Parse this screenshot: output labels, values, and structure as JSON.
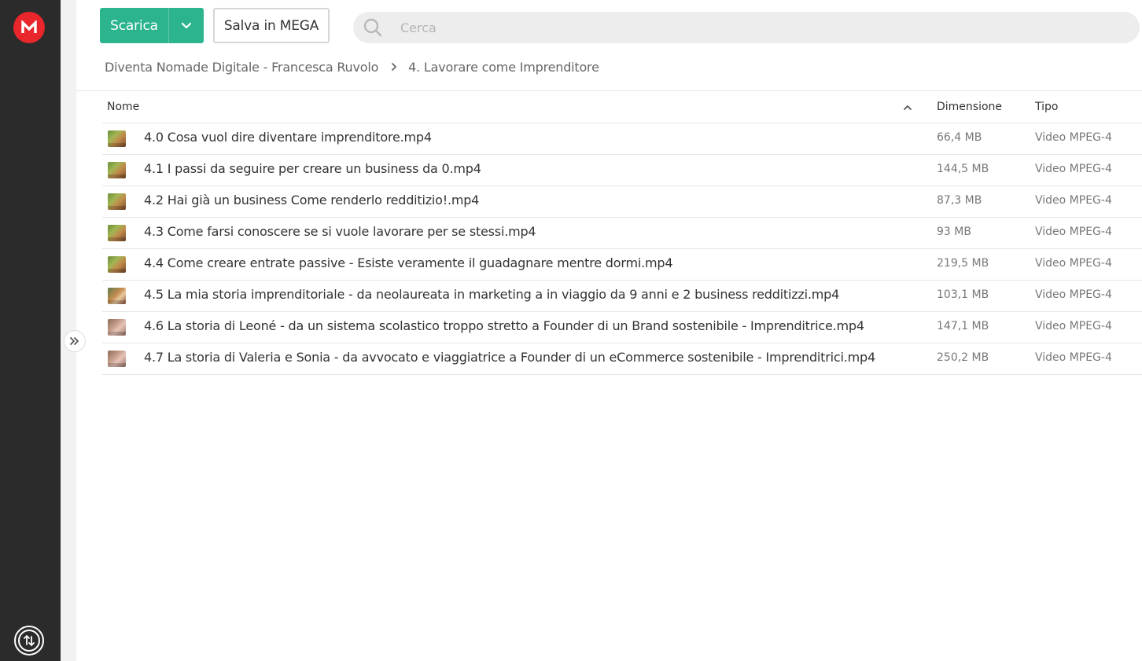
{
  "toolbar": {
    "download_label": "Scarica",
    "save_label": "Salva in MEGA"
  },
  "search": {
    "placeholder": "Cerca"
  },
  "breadcrumb": {
    "parent": "Diventa Nomade Digitale - Francesca Ruvolo",
    "current": "4. Lavorare come Imprenditore"
  },
  "table": {
    "headers": {
      "name": "Nome",
      "size": "Dimensione",
      "type": "Tipo"
    },
    "rows": [
      {
        "name": "4.0 Cosa vuol dire diventare imprenditore.mp4",
        "size": "66,4 MB",
        "type": "Video MPEG-4"
      },
      {
        "name": "4.1 I passi da seguire per creare un business da 0.mp4",
        "size": "144,5 MB",
        "type": "Video MPEG-4"
      },
      {
        "name": "4.2 Hai già un business Come renderlo redditizio!.mp4",
        "size": "87,3 MB",
        "type": "Video MPEG-4"
      },
      {
        "name": "4.3 Come farsi conoscere se si vuole lavorare per se stessi.mp4",
        "size": "93 MB",
        "type": "Video MPEG-4"
      },
      {
        "name": "4.4 Come creare entrate passive - Esiste veramente il guadagnare mentre dormi.mp4",
        "size": "219,5 MB",
        "type": "Video MPEG-4"
      },
      {
        "name": "4.5 La mia storia imprenditoriale - da neolaureata in marketing a in viaggio da 9 anni e 2 business redditizzi.mp4",
        "size": "103,1 MB",
        "type": "Video MPEG-4"
      },
      {
        "name": "4.6 La storia di Leoné - da un sistema scolastico troppo stretto a Founder di un Brand sostenibile - Imprenditrice.mp4",
        "size": "147,1 MB",
        "type": "Video MPEG-4"
      },
      {
        "name": "4.7 La storia di Valeria e Sonia - da avvocato e viaggiatrice a Founder di un eCommerce sostenibile - Imprenditrici.mp4",
        "size": "250,2 MB",
        "type": "Video MPEG-4"
      }
    ]
  },
  "colors": {
    "accent_green": "#2bb48e",
    "brand_red": "#e8262b",
    "sidebar": "#2b2b2b"
  }
}
